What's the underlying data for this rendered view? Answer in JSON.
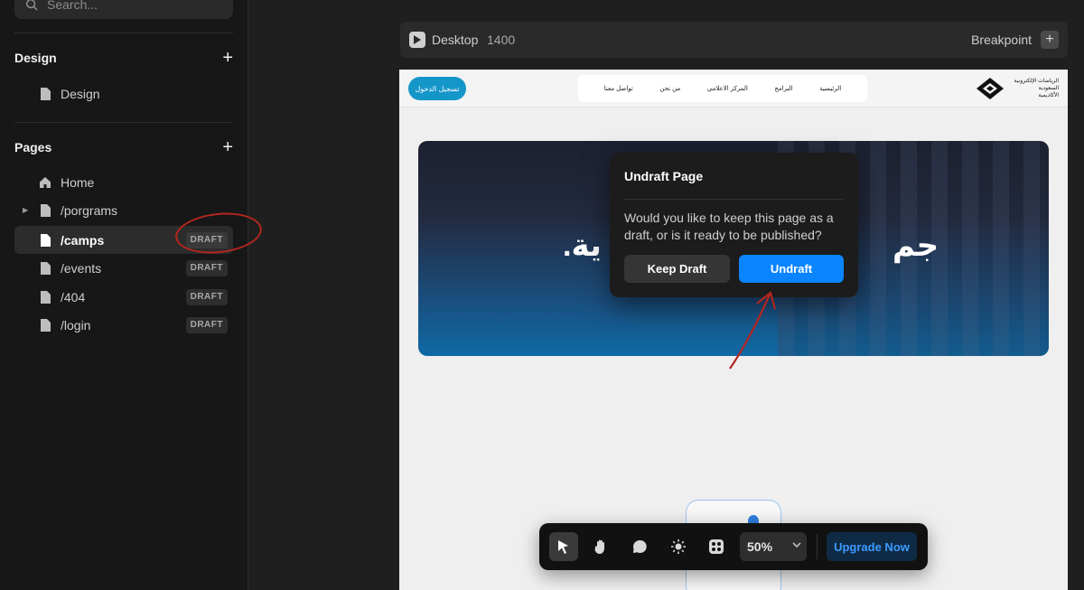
{
  "sidebar": {
    "search_placeholder": "Search...",
    "design_section": {
      "title": "Design",
      "items": [
        {
          "label": "Design"
        }
      ]
    },
    "pages_section": {
      "title": "Pages",
      "items": [
        {
          "label": "Home",
          "icon": "home-icon"
        },
        {
          "label": "/porgrams",
          "icon": "file-icon",
          "expandable": true
        },
        {
          "label": "/camps",
          "icon": "file-icon",
          "badge": "DRAFT",
          "selected": true
        },
        {
          "label": "/events",
          "icon": "file-icon",
          "badge": "DRAFT"
        },
        {
          "label": "/404",
          "icon": "file-icon",
          "badge": "DRAFT"
        },
        {
          "label": "/login",
          "icon": "file-icon",
          "badge": "DRAFT"
        }
      ]
    }
  },
  "breakpoint_bar": {
    "device": "Desktop",
    "width": "1400",
    "right_label": "Breakpoint"
  },
  "site_preview": {
    "login_button": "تسجيل الدخول",
    "nav": [
      "الرئيسية",
      "البرامج",
      "المركز الاعلامي",
      "من نحن",
      "تواصل معنا"
    ],
    "logo_text": [
      "الرياضات الإلكترونية",
      "السعودية",
      "الأكاديمية"
    ],
    "hero_text_left": "ية.",
    "hero_text_right": "جم"
  },
  "modal": {
    "title": "Undraft Page",
    "body": "Would you like to keep this page as a draft, or is it ready to be published?",
    "keep_button": "Keep Draft",
    "undraft_button": "Undraft"
  },
  "toolbar": {
    "zoom": "50%",
    "upgrade_button": "Upgrade Now",
    "tools": [
      "select-tool-icon",
      "hand-tool-icon",
      "comment-icon",
      "theme-icon",
      "components-icon"
    ]
  },
  "colors": {
    "accent": "#0a84ff",
    "annotation": "#b3261e",
    "hero_blue": "#0f6aa5"
  }
}
